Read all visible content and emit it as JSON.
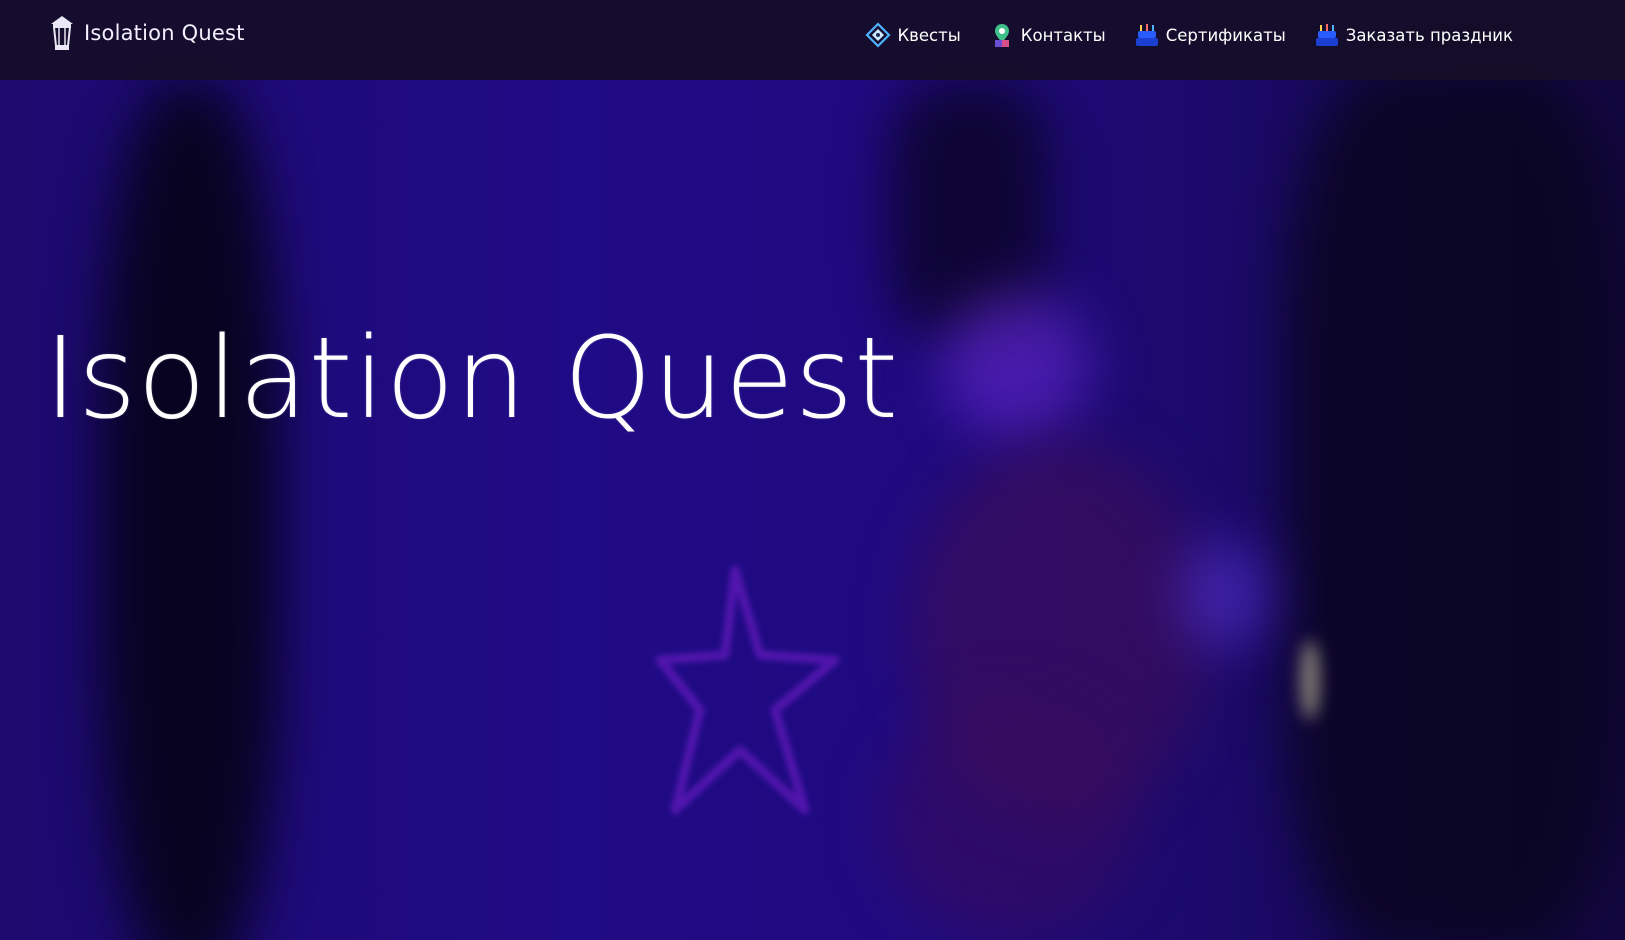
{
  "brand": {
    "name": "Isolation Quest",
    "icon": "lantern-icon"
  },
  "nav": {
    "items": [
      {
        "label": "Квесты",
        "icon": "compass-diamond-icon"
      },
      {
        "label": "Контакты",
        "icon": "map-pin-person-icon"
      },
      {
        "label": "Сертификаты",
        "icon": "cake-icon"
      },
      {
        "label": "Заказать праздник",
        "icon": "cake-icon"
      }
    ]
  },
  "hero": {
    "title": "Isolation Quest"
  },
  "colors": {
    "navbar_bg": "#140e28",
    "hero_bg": "#200b86",
    "text": "#ffffff",
    "icon_accent": "#4fb3ff",
    "icon_cake": "#2a5bff"
  }
}
